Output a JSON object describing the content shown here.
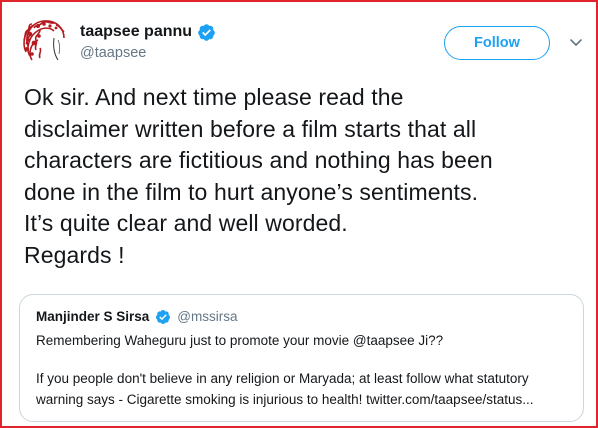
{
  "tweet": {
    "author": {
      "display_name": "taapsee pannu",
      "handle": "@taapsee",
      "verified": true,
      "avatar_icon": "red-curly-hair-avatar",
      "verified_icon": "verified-badge-icon"
    },
    "follow_label": "Follow",
    "menu_icon": "chevron-down-icon",
    "text": "Ok sir. And next time please read the\ndisclaimer written before a film starts that all\ncharacters are fictitious and nothing has been\ndone in the film to hurt anyone’s sentiments.\nIt’s quite clear and well worded.\nRegards !",
    "quoted": {
      "display_name": "Manjinder S Sirsa",
      "handle": "@mssirsa",
      "line1": "Remembering Waheguru just to promote your movie @taapsee Ji??",
      "line2": "If you people don't believe in any religion or Maryada; at least follow what statutory",
      "line3": "warning says - Cigarette smoking is injurious to health! twitter.com/taapsee/status..."
    }
  },
  "colors": {
    "frame_border": "#e0242b",
    "accent": "#1da1f2",
    "text_primary": "#14171a",
    "text_secondary": "#657786",
    "quote_border": "#ccd6dd"
  }
}
